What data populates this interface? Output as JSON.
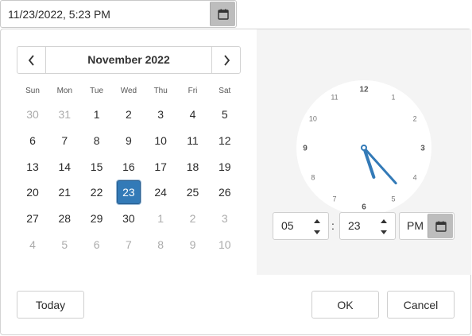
{
  "input": {
    "value": "11/23/2022, 5:23 PM",
    "icon": "calendar-icon"
  },
  "calendar": {
    "month_label": "November 2022",
    "prev_icon": "chevron-left-icon",
    "next_icon": "chevron-right-icon",
    "weekdays": [
      "Sun",
      "Mon",
      "Tue",
      "Wed",
      "Thu",
      "Fri",
      "Sat"
    ],
    "weeks": [
      [
        {
          "d": "30",
          "m": true
        },
        {
          "d": "31",
          "m": true
        },
        {
          "d": "1"
        },
        {
          "d": "2"
        },
        {
          "d": "3"
        },
        {
          "d": "4"
        },
        {
          "d": "5"
        }
      ],
      [
        {
          "d": "6"
        },
        {
          "d": "7"
        },
        {
          "d": "8"
        },
        {
          "d": "9"
        },
        {
          "d": "10"
        },
        {
          "d": "11"
        },
        {
          "d": "12"
        }
      ],
      [
        {
          "d": "13"
        },
        {
          "d": "14"
        },
        {
          "d": "15"
        },
        {
          "d": "16"
        },
        {
          "d": "17"
        },
        {
          "d": "18"
        },
        {
          "d": "19"
        }
      ],
      [
        {
          "d": "20"
        },
        {
          "d": "21"
        },
        {
          "d": "22"
        },
        {
          "d": "23",
          "sel": true
        },
        {
          "d": "24"
        },
        {
          "d": "25"
        },
        {
          "d": "26"
        }
      ],
      [
        {
          "d": "27"
        },
        {
          "d": "28"
        },
        {
          "d": "29"
        },
        {
          "d": "30"
        },
        {
          "d": "1",
          "m": true
        },
        {
          "d": "2",
          "m": true
        },
        {
          "d": "3",
          "m": true
        }
      ],
      [
        {
          "d": "4",
          "m": true
        },
        {
          "d": "5",
          "m": true
        },
        {
          "d": "6",
          "m": true
        },
        {
          "d": "7",
          "m": true
        },
        {
          "d": "8",
          "m": true
        },
        {
          "d": "9",
          "m": true
        },
        {
          "d": "10",
          "m": true
        }
      ]
    ],
    "selected_color": "#337ab7"
  },
  "clock": {
    "numbers": [
      "12",
      "1",
      "2",
      "3",
      "4",
      "5",
      "6",
      "7",
      "8",
      "9",
      "10",
      "11"
    ],
    "bold_numbers": [
      "12",
      "3",
      "6",
      "9"
    ],
    "hour": 5,
    "minute": 23,
    "hand_color": "#337ab7"
  },
  "time": {
    "hours": "05",
    "separator": ":",
    "minutes": "23",
    "ampm": "PM",
    "up_icon": "caret-up-icon",
    "down_icon": "caret-down-icon",
    "ampm_icon": "calendar-icon"
  },
  "footer": {
    "today_label": "Today",
    "ok_label": "OK",
    "cancel_label": "Cancel"
  }
}
